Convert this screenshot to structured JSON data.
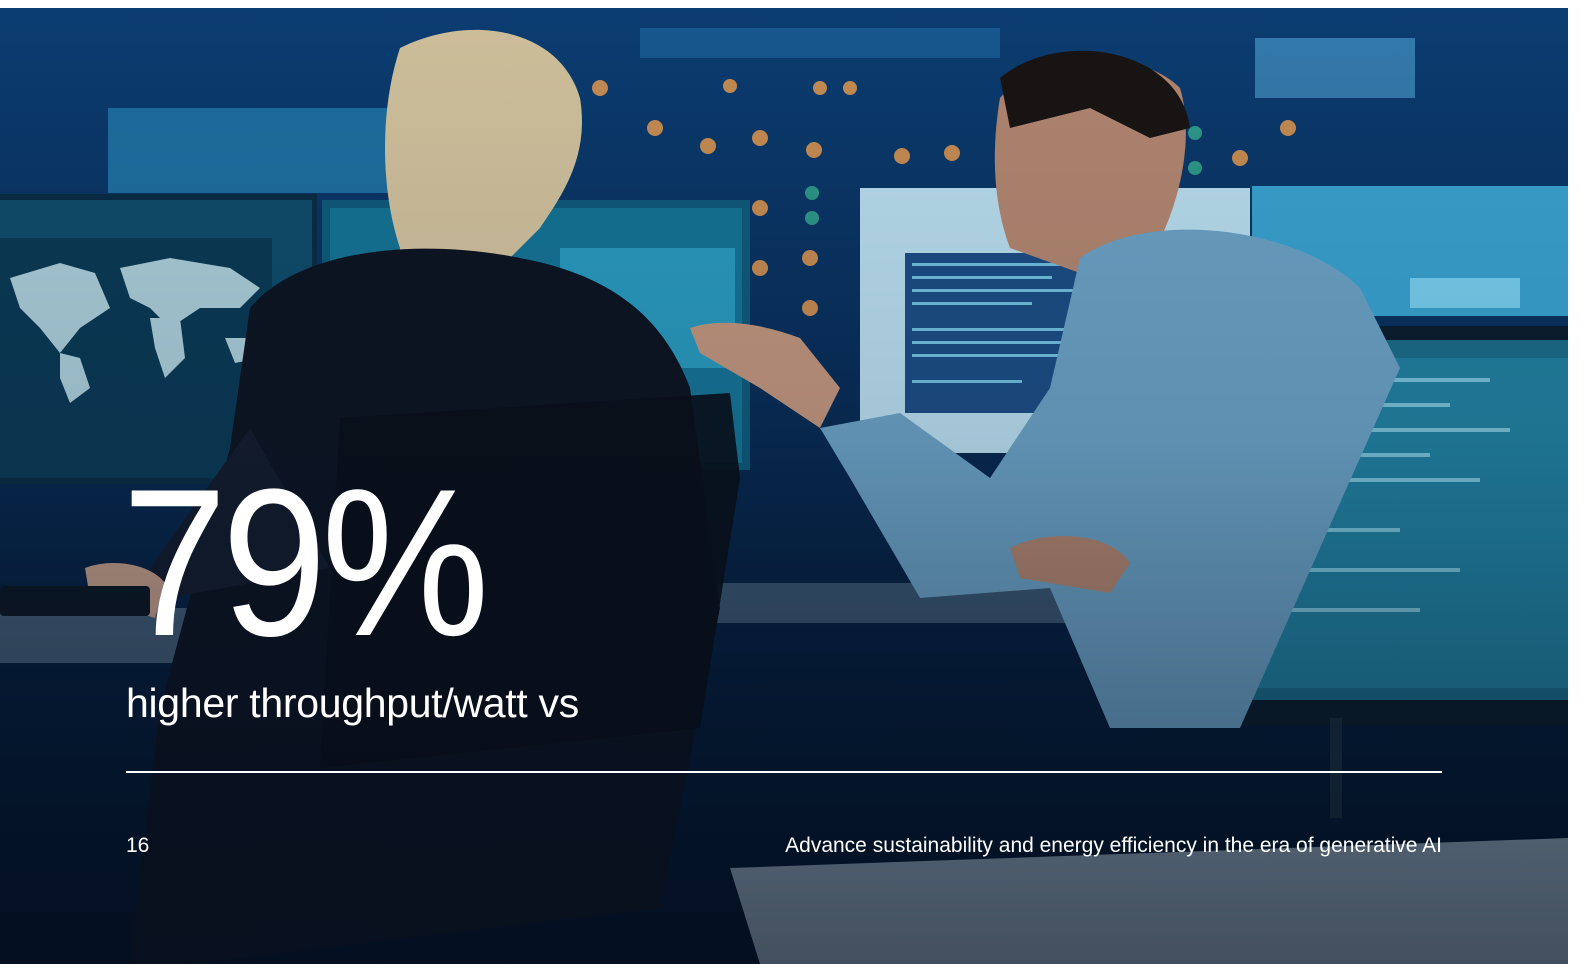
{
  "slide": {
    "stat_value": "79%",
    "stat_caption": "higher throughput/watt vs",
    "page_number": "16",
    "footer_title": "Advance sustainability and energy efficiency in the era of generative AI"
  },
  "colors": {
    "background": "#082a52",
    "text": "#ffffff",
    "screen_glow": "#5fd4ff"
  },
  "photo": {
    "subject": "two people working at monitors in a control room"
  }
}
